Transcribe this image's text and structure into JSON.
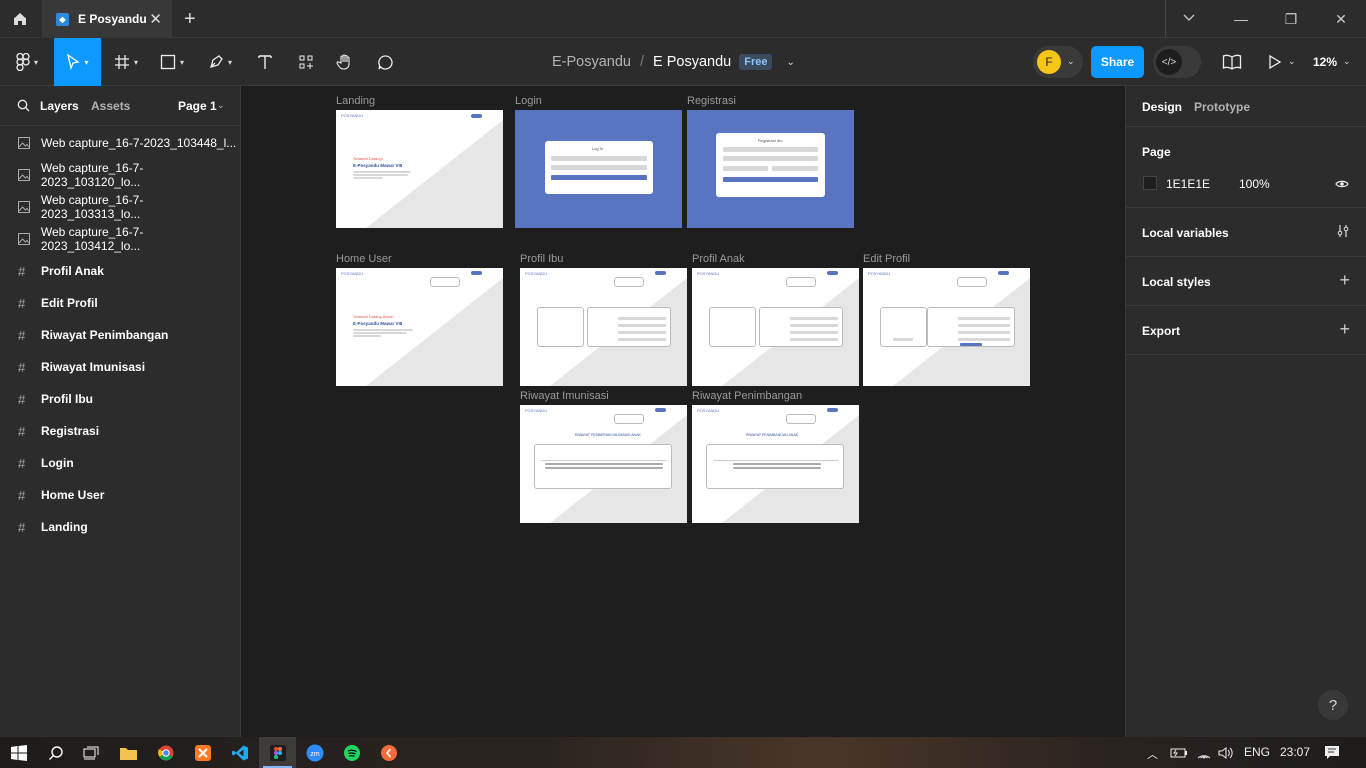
{
  "browser": {
    "tab_title": "E Posyandu",
    "new_tab": "+",
    "window_controls": {
      "minimize": "—",
      "maximize": "❐",
      "close": "✕"
    }
  },
  "toolbar": {
    "project": "E-Posyandu",
    "separator": "/",
    "file": "E Posyandu",
    "plan_badge": "Free",
    "avatar_initial": "F",
    "share_label": "Share",
    "zoom": "12%"
  },
  "left_panel": {
    "tabs": [
      "Layers",
      "Assets"
    ],
    "page_selector": "Page 1",
    "layers": [
      {
        "type": "image",
        "label": "Web capture_16-7-2023_103448_l..."
      },
      {
        "type": "image",
        "label": "Web capture_16-7-2023_103120_lo..."
      },
      {
        "type": "image",
        "label": "Web capture_16-7-2023_103313_lo..."
      },
      {
        "type": "image",
        "label": "Web capture_16-7-2023_103412_lo..."
      },
      {
        "type": "frame",
        "label": "Profil Anak"
      },
      {
        "type": "frame",
        "label": "Edit Profil"
      },
      {
        "type": "frame",
        "label": "Riwayat Penimbangan"
      },
      {
        "type": "frame",
        "label": "Riwayat Imunisasi"
      },
      {
        "type": "frame",
        "label": "Profil Ibu"
      },
      {
        "type": "frame",
        "label": "Registrasi"
      },
      {
        "type": "frame",
        "label": "Login"
      },
      {
        "type": "frame",
        "label": "Home User"
      },
      {
        "type": "frame",
        "label": "Landing"
      }
    ]
  },
  "canvas": {
    "frames": [
      {
        "name": "Landing"
      },
      {
        "name": "Login"
      },
      {
        "name": "Registrasi"
      },
      {
        "name": "Home User"
      },
      {
        "name": "Profil Ibu"
      },
      {
        "name": "Profil Anak"
      },
      {
        "name": "Edit Profil"
      },
      {
        "name": "Riwayat Imunisasi"
      },
      {
        "name": "Riwayat Penimbangan"
      }
    ],
    "thumb_text": {
      "brand": "POSYANDU",
      "landing_greeting": "Selamat Datang!",
      "landing_headline": "E-Posyandu Mawar VIII",
      "home_greeting": "Selamat Datang Ahlak!",
      "home_headline": "E-Posyandu Mawar VIII",
      "login_title": "Log In",
      "register_title": "Registrasi Ibu",
      "imunisasi_title": "RIWAYAT PEMBERIAN IMUNISASI ANAK",
      "penimbangan_title": "RIWAYAT PENIMBANGAN ANAK"
    }
  },
  "right_panel": {
    "tabs": [
      "Design",
      "Prototype"
    ],
    "page_section": "Page",
    "page_color": "1E1E1E",
    "page_opacity": "100%",
    "sections": [
      "Local variables",
      "Local styles",
      "Export"
    ],
    "help": "?"
  },
  "taskbar": {
    "language": "ENG",
    "time": "23:07"
  }
}
